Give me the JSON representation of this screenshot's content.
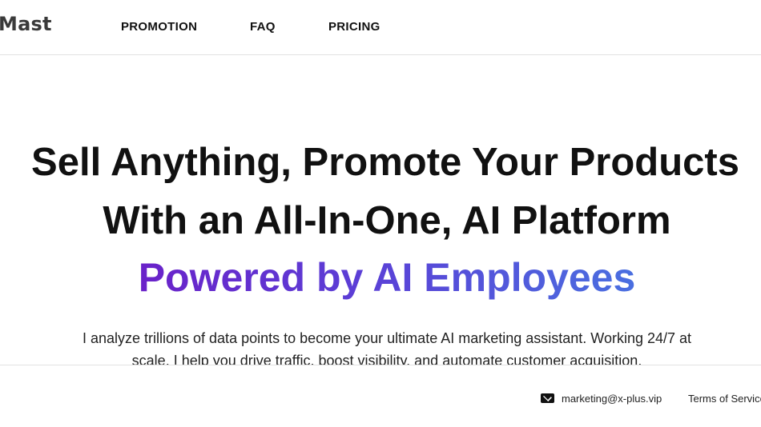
{
  "header": {
    "logo": "Mast",
    "nav": [
      {
        "label": "PROMOTION"
      },
      {
        "label": "FAQ"
      },
      {
        "label": "PRICING"
      }
    ]
  },
  "hero": {
    "headline_line1": "Sell Anything, Promote Your Products",
    "headline_line2": "With an All-In-One, AI Platform",
    "subheadline": "Powered by AI Employees",
    "description_line1": "I analyze trillions of data points to become your ultimate AI marketing assistant. Working 24/7 at",
    "description_line2": "scale, I help you drive traffic, boost visibility, and automate customer acquisition."
  },
  "footer": {
    "email_icon": "envelope-icon",
    "email": "marketing@x-plus.vip",
    "terms": "Terms of Service"
  },
  "colors": {
    "gradient_start": "#6a22c9",
    "gradient_end": "#4a6fe0",
    "text": "#111111",
    "divider": "#e2e2e2"
  }
}
